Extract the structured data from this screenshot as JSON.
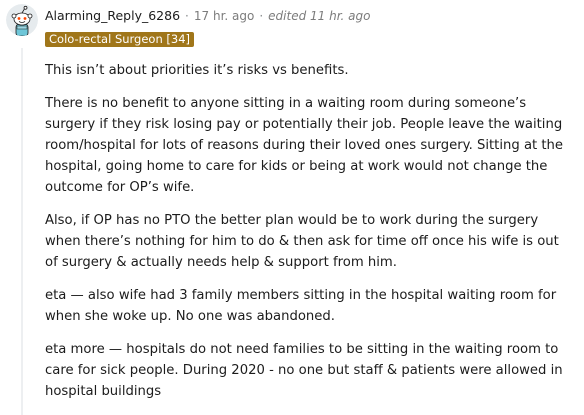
{
  "comment": {
    "username": "Alarming_Reply_6286",
    "separator": "·",
    "time": "17 hr. ago",
    "edited": "edited 11 hr. ago",
    "flair": "Colo-rectal Surgeon [34]",
    "paragraphs": [
      "This isn’t about priorities it’s risks vs benefits.",
      "There is no benefit to anyone sitting in a waiting room during someone’s surgery if they risk losing pay or potentially their job. People leave the waiting room/hospital for lots of reasons during their loved ones surgery. Sitting at the hospital, going home to care for kids or being at work would not change the outcome for OP’s wife.",
      "Also, if OP has no PTO the better plan would be to work during the surgery when there’s nothing for him to do & then ask for time off once his wife is out of surgery & actually needs help & support from him.",
      "eta — also wife had 3 family members sitting in the hospital waiting room for when she woke up. No one was abandoned.",
      "eta more — hospitals do not need families to be sitting in the waiting room to care for sick people. During 2020 - no one but staff & patients were allowed in hospital buildings"
    ]
  },
  "colors": {
    "flair_bg": "#a0761a",
    "meta_gray": "#7c7c7c",
    "text": "#1c1c1c"
  },
  "icons": {
    "avatar": "snoo-avatar-icon"
  }
}
